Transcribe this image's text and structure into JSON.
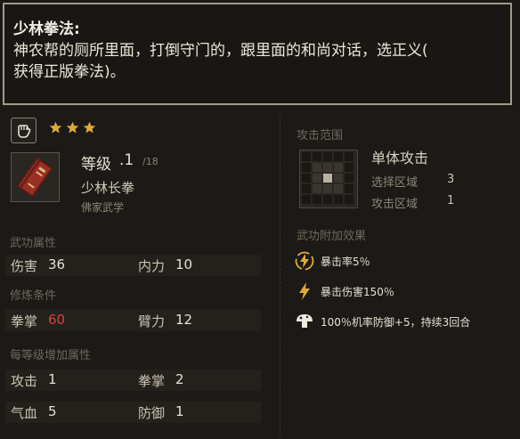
{
  "tooltip": {
    "title": "少林拳法:",
    "line1": "神农帮的厕所里面，打倒守门的，跟里面的和尚对话，选正义(",
    "line2": "获得正版拳法)。"
  },
  "skill": {
    "stars": 3,
    "level_label": "等级",
    "level_value": ".1",
    "level_max": "/18",
    "name": "少林长拳",
    "school": "佛家武学"
  },
  "sections": {
    "attributes": "武功属性",
    "requirements": "修炼条件",
    "per_level": "每等级增加属性",
    "attack_range": "攻击范围",
    "extra_effects": "武功附加效果"
  },
  "attributes": [
    {
      "label": "伤害",
      "value": "36"
    },
    {
      "label": "内力",
      "value": "10"
    }
  ],
  "requirements": [
    {
      "label": "拳掌",
      "value": "60",
      "status": "insufficient"
    },
    {
      "label": "臂力",
      "value": "12"
    }
  ],
  "per_level": [
    {
      "label": "攻击",
      "value": "1"
    },
    {
      "label": "拳掌",
      "value": "2"
    },
    {
      "label": "气血",
      "value": "5"
    },
    {
      "label": "防御",
      "value": "1"
    }
  ],
  "range": {
    "type": "单体攻击",
    "select_label": "选择区域",
    "select_value": "3",
    "attack_label": "攻击区域",
    "attack_value": "1"
  },
  "effects": [
    {
      "icon": "lightning-circle-icon",
      "text": "暴击率5％"
    },
    {
      "icon": "lightning-icon",
      "text": "暴击伤害150％"
    },
    {
      "icon": "defense-mushroom-icon",
      "text": "100％机率防御+5，持续3回合"
    }
  ],
  "colors": {
    "gold": "#e0a93a",
    "requirement_unmet": "#d9443a"
  }
}
